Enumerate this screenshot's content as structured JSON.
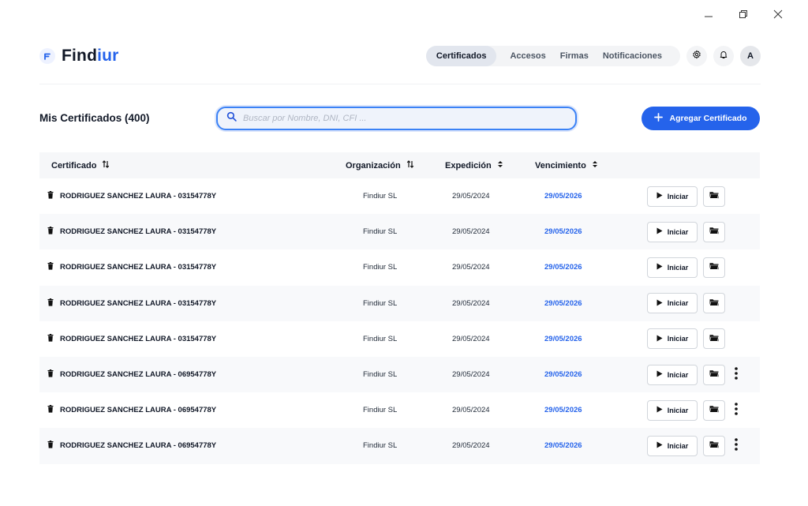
{
  "app": {
    "logo_prefix": "Find",
    "logo_accent": "iur",
    "brand_color": "#2563eb"
  },
  "nav": [
    {
      "label": "Certificados",
      "active": true
    },
    {
      "label": "Accesos",
      "active": false
    },
    {
      "label": "Firmas",
      "active": false
    },
    {
      "label": "Notificaciones",
      "active": false
    }
  ],
  "avatar_initial": "A",
  "page": {
    "title": "Mis Certificados (400)"
  },
  "search": {
    "placeholder": "Buscar por Nombre, DNI, CFI ..."
  },
  "add_button": {
    "label": "Agregar Certificado"
  },
  "table": {
    "columns": [
      "Certificado",
      "Organización",
      "Expedición",
      "Vencimiento"
    ],
    "rows": [
      {
        "name": "RODRIGUEZ SANCHEZ LAURA - 03154778Y",
        "org": "Findiur SL",
        "exp": "29/05/2024",
        "venc": "29/05/2026",
        "action": "Iniciar",
        "more": false
      },
      {
        "name": "RODRIGUEZ SANCHEZ LAURA - 03154778Y",
        "org": "Findiur SL",
        "exp": "29/05/2024",
        "venc": "29/05/2026",
        "action": "Iniciar",
        "more": false
      },
      {
        "name": "RODRIGUEZ SANCHEZ LAURA - 03154778Y",
        "org": "Findiur SL",
        "exp": "29/05/2024",
        "venc": "29/05/2026",
        "action": "Iniciar",
        "more": false
      },
      {
        "name": "RODRIGUEZ SANCHEZ LAURA - 03154778Y",
        "org": "Findiur SL",
        "exp": "29/05/2024",
        "venc": "29/05/2026",
        "action": "Iniciar",
        "more": false
      },
      {
        "name": "RODRIGUEZ SANCHEZ LAURA - 03154778Y",
        "org": "Findiur SL",
        "exp": "29/05/2024",
        "venc": "29/05/2026",
        "action": "Iniciar",
        "more": false
      },
      {
        "name": "RODRIGUEZ SANCHEZ LAURA - 06954778Y",
        "org": "Findiur SL",
        "exp": "29/05/2024",
        "venc": "29/05/2026",
        "action": "Iniciar",
        "more": true
      },
      {
        "name": "RODRIGUEZ SANCHEZ LAURA - 06954778Y",
        "org": "Findiur SL",
        "exp": "29/05/2024",
        "venc": "29/05/2026",
        "action": "Iniciar",
        "more": true
      },
      {
        "name": "RODRIGUEZ SANCHEZ LAURA - 06954778Y",
        "org": "Findiur SL",
        "exp": "29/05/2024",
        "venc": "29/05/2026",
        "action": "Iniciar",
        "more": true
      }
    ]
  }
}
